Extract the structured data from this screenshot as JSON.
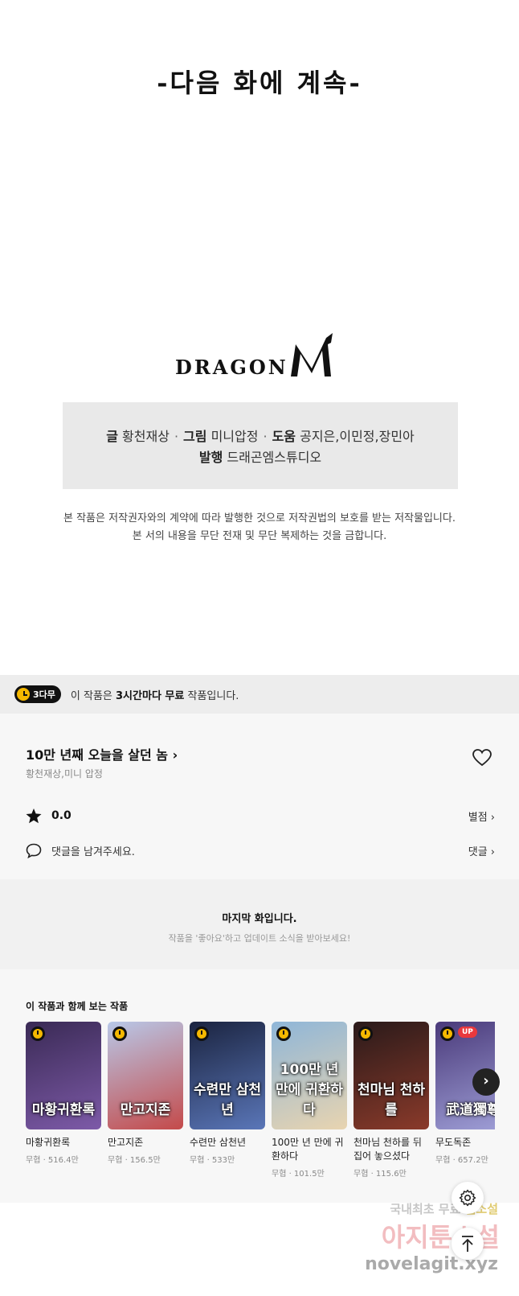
{
  "episode_end": {
    "continued_text": "-다음 화에 계속-",
    "logo_text": "DRAGON",
    "credits": {
      "writer_label": "글",
      "writer": "황천재상",
      "art_label": "그림",
      "art": "미니압정",
      "assist_label": "도움",
      "assist": "공지은,이민정,장민아",
      "publisher_label": "발행",
      "publisher": "드래곤엠스튜디오"
    },
    "copyright_line1": "본 작품은 저작권자와의 계약에 따라 발행한 것으로 저작권법의 보호를 받는 저작물입니다.",
    "copyright_line2": "본 서의 내용을 무단 전재 및 무단 복제하는 것을 금합니다."
  },
  "free_banner": {
    "badge": "3다무",
    "text_prefix": "이 작품은 ",
    "text_bold": "3시간마다 무료",
    "text_suffix": " 작품입니다."
  },
  "series": {
    "title": "10만 년째 오늘을 살던 놈 ›",
    "authors": "황천재상,미니 압정",
    "rating": "0.0",
    "rating_link": "별점 ›",
    "comment_prompt": "댓글을 남겨주세요.",
    "comment_link": "댓글 ›"
  },
  "last_episode": {
    "title": "마지막 화입니다.",
    "subtitle": "작품을 '좋아요'하고 업데이트 소식을 받아보세요!"
  },
  "recommend": {
    "heading": "이 작품과 함께 보는 작품",
    "items": [
      {
        "name": "마황귀환록",
        "meta": "무협 · 516.4만",
        "cover_text": "마황귀환록",
        "colors": [
          "#3a2a55",
          "#7d5aa8"
        ],
        "up": false
      },
      {
        "name": "만고지존",
        "meta": "무협 · 156.5만",
        "cover_text": "만고지존",
        "colors": [
          "#b8c8e8",
          "#c44a4a"
        ],
        "up": false
      },
      {
        "name": "수련만 삼천년",
        "meta": "무협 · 533만",
        "cover_text": "수련만 삼천년",
        "colors": [
          "#1b2440",
          "#5a76b8"
        ],
        "up": false
      },
      {
        "name": "100만 년 만에 귀환하다",
        "meta": "무협 · 101.5만",
        "cover_text": "100만 년 만에 귀환하다",
        "colors": [
          "#8fb6d8",
          "#e8d4b0"
        ],
        "up": false
      },
      {
        "name": "천마님 천하를 뒤집어 놓으셨다",
        "meta": "무협 · 115.6만",
        "cover_text": "천마님 천하를",
        "colors": [
          "#2a1a1a",
          "#8a3a2a"
        ],
        "up": false
      },
      {
        "name": "무도독존",
        "meta": "무협 · 657.2만",
        "cover_text": "武道獨尊",
        "colors": [
          "#4a3a7a",
          "#a0a0d8"
        ],
        "up": true,
        "up_label": "UP"
      }
    ]
  },
  "watermark": {
    "line1a": "국내최초 무료 ",
    "line1b": "웹소설",
    "line2": "아지툰소설",
    "line3": "novelagit.xyz"
  }
}
